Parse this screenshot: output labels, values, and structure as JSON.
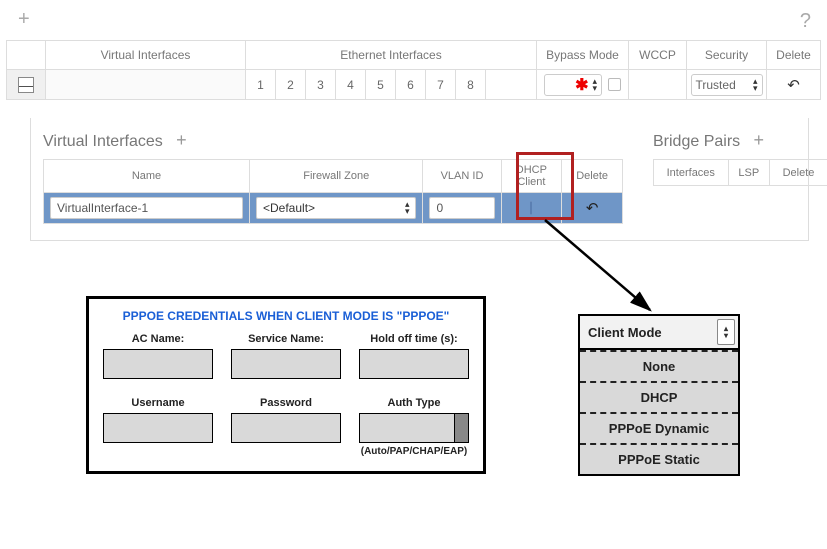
{
  "toolbar": {
    "plus": "+",
    "help": "?"
  },
  "header": {
    "virtual_interfaces": "Virtual Interfaces",
    "ethernet_interfaces": "Ethernet Interfaces",
    "bypass_mode": "Bypass Mode",
    "wccp": "WCCP",
    "security": "Security",
    "delete": "Delete"
  },
  "eth_numbers": [
    "1",
    "2",
    "3",
    "4",
    "5",
    "6",
    "7",
    "8"
  ],
  "bypass_symbol": "✱",
  "security_select_value": "Trusted",
  "collapse_glyph": "—",
  "revert_glyph": "↶",
  "section_vi": {
    "title": "Virtual Interfaces",
    "plus": "+",
    "cols": {
      "name": "Name",
      "fz": "Firewall Zone",
      "vlan": "VLAN ID",
      "dhcp_l1": "DHCP",
      "dhcp_l2": "Client",
      "delete": "Delete"
    },
    "row": {
      "name": "VirtualInterface-1",
      "fz": "<Default>",
      "vlan": "0"
    }
  },
  "section_bp": {
    "title": "Bridge Pairs",
    "plus": "+",
    "cols": {
      "interfaces": "Interfaces",
      "lsp": "LSP",
      "delete": "Delete"
    }
  },
  "pppoe": {
    "title": "PPPOE CREDENTIALS WHEN CLIENT MODE IS \"PPPOE\"",
    "ac": "AC Name:",
    "service": "Service Name:",
    "hold": "Hold off time (s):",
    "user": "Username",
    "pass": "Password",
    "auth": "Auth Type",
    "auth_note": "(Auto/PAP/CHAP/EAP)"
  },
  "client_mode": {
    "header": "Client Mode",
    "options": [
      "None",
      "DHCP",
      "PPPoE Dynamic",
      "PPPoE Static"
    ]
  }
}
